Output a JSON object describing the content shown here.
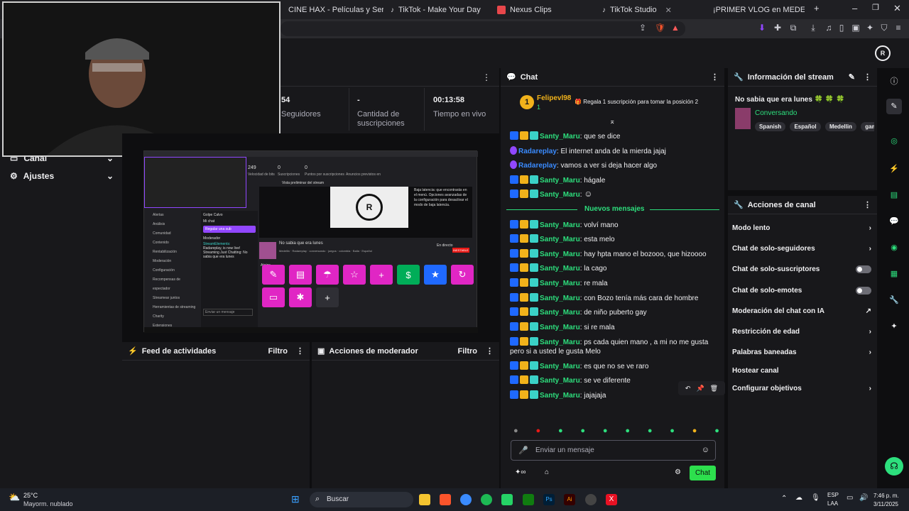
{
  "browser": {
    "tabs": [
      {
        "label": "CINE HAX - Películas y Series GRA",
        "color": "#1a1a3a"
      },
      {
        "label": "TikTok - Make Your Day",
        "color": "#111"
      },
      {
        "label": "Nexus Clips",
        "color": "#e8474b"
      },
      {
        "label": "TikTok Studio",
        "color": "#111"
      },
      {
        "label": "¡PRIMER VLOG en MEDELLIN! co",
        "color": "#ff0000"
      }
    ],
    "new_tab": "+",
    "min": "–",
    "max": "❐",
    "close": "✕"
  },
  "sidebar": {
    "items": [
      {
        "label": "Canal",
        "icon": "channel-icon"
      },
      {
        "label": "Ajustes",
        "icon": "gear-icon"
      }
    ]
  },
  "stats": {
    "followers_value": "54",
    "followers_label": "Seguidores",
    "subs_value": "-",
    "subs_label": "Cantidad de suscripciones",
    "live_value": "00:13:58",
    "live_label": "Tiempo en vivo"
  },
  "panels": {
    "feed_title": "Feed de actividades",
    "feed_filter": "Filtro",
    "mod_title": "Acciones de moderador",
    "mod_filter": "Filtro"
  },
  "chat": {
    "title": "Chat",
    "pinned_user": "Felipevl98",
    "pinned_rank": "1",
    "pinned_count": "1",
    "gift_text": "Regala 1 suscripción para tomar la posición 2",
    "new_messages": "Nuevos mensajes",
    "input_placeholder": "Enviar un mensaje",
    "send_label": "Chat",
    "messages_before": [
      {
        "user": "Santy_Maru",
        "text": "que se dice",
        "kind": "green"
      },
      {
        "user": "Radareplay",
        "text": "El internet anda de la mierda jajaj",
        "kind": "blue"
      },
      {
        "user": "Radareplay",
        "text": "vamos a ver si deja hacer algo",
        "kind": "blue"
      },
      {
        "user": "Santy_Maru",
        "text": "hágale",
        "kind": "green"
      },
      {
        "user": "Santy_Maru",
        "text": "",
        "kind": "green"
      }
    ],
    "messages_after": [
      {
        "user": "Santy_Maru",
        "text": "volví mano"
      },
      {
        "user": "Santy_Maru",
        "text": "esta melo"
      },
      {
        "user": "Santy_Maru",
        "text": "hay hpta mano el bozooo, que hizoooo"
      },
      {
        "user": "Santy_Maru",
        "text": "la cago"
      },
      {
        "user": "Santy_Maru",
        "text": "re mala"
      },
      {
        "user": "Santy_Maru",
        "text": "con Bozo tenía más cara de hombre"
      },
      {
        "user": "Santy_Maru",
        "text": "de niño puberto gay"
      },
      {
        "user": "Santy_Maru",
        "text": "si re mala"
      },
      {
        "user": "Santy_Maru",
        "text": "ps cada quien mano , a mi no me gusta pero si a usted le gusta Melo"
      },
      {
        "user": "Santy_Maru",
        "text": "es que no se ve raro"
      },
      {
        "user": "Santy_Maru",
        "text": "se ve diferente"
      },
      {
        "user": "Santy_Maru",
        "text": "jajajaja"
      }
    ]
  },
  "info": {
    "title": "Información del stream",
    "stream_title": "No sabia que era lunes 🍀 🍀 🍀",
    "category": "Conversando",
    "tags": [
      "Spanish",
      "Español",
      "Medellin",
      "gam"
    ]
  },
  "actions": {
    "title": "Acciones de canal",
    "items": [
      {
        "label": "Modo lento",
        "control": "chevron"
      },
      {
        "label": "Chat de solo-seguidores",
        "control": "chevron"
      },
      {
        "label": "Chat de solo-suscriptores",
        "control": "toggle"
      },
      {
        "label": "Chat de solo-emotes",
        "control": "toggle"
      },
      {
        "label": "Moderación del chat con IA",
        "control": "external"
      },
      {
        "label": "Restricción de edad",
        "control": "chevron"
      },
      {
        "label": "Palabras baneadas",
        "control": "chevron"
      },
      {
        "label": "Hostear canal",
        "control": "none"
      },
      {
        "label": "Configurar objetivos",
        "control": "chevron"
      }
    ]
  },
  "preview": {
    "mini_stats": [
      "249",
      "Velocidad de bits",
      "0",
      "Suscripciones",
      "0",
      "Puntos por suscripciones",
      "Anuncios previstos en"
    ],
    "mini_sidebar": [
      "Alertas",
      "Análisis",
      "Comunidad",
      "Contenido",
      "Rentabilización",
      "Moderación",
      "Configuración",
      "Recompensas de espectador",
      "Streamear juntos",
      "Herramientas de streaming",
      "Charity",
      "Extensiones"
    ],
    "mini_chat_user": "Golpe Calvo",
    "mini_chat_btn": "Regalar una sub",
    "mini_chat_line": "Streaming Just Chatting: No sabia que era lunes",
    "mini_title": "No sabia que era lunes",
    "mini_status": "En directo",
    "mini_status2": "INESTABLE",
    "mini_latency": "Baja latencia: que encontrarás en el menú. Opciones avanzadas de la configuración para desactivar el modo de baja latencia.",
    "mini_tags": [
      "Medellin",
      "Radareplay",
      "conversando",
      "juegos",
      "colombia",
      "Balla",
      "Español"
    ],
    "mini_placeholder": "Enviar un mensaje",
    "mini_shortcuts": "Atajos",
    "mini_preview_label": "Vista preliminar del stream",
    "mini_moderator": "Moderador",
    "mini_elements": "StreamElements:",
    "mini_radarplay": "Radareplay, is now live!",
    "mini_mychat": "Mi chat"
  },
  "taskbar": {
    "weather_temp": "25°C",
    "weather_desc": "Mayorm. nublado",
    "search": "Buscar",
    "lang1": "ESP",
    "lang2": "LAA",
    "time": "7:46 p. m.",
    "date": "3/11/2025"
  }
}
